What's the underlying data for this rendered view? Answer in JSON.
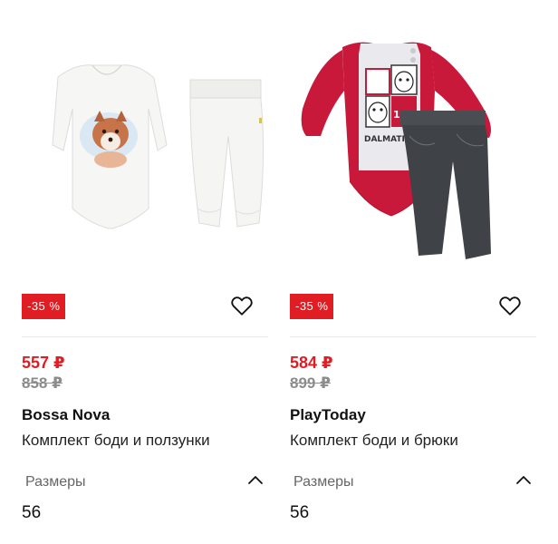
{
  "products": [
    {
      "discount": "-35 %",
      "price_new": "557 ₽",
      "price_old": "858 ₽",
      "brand": "Bossa Nova",
      "title": "Комплект боди и ползунки",
      "sizes_label": "Размеры",
      "size": "56"
    },
    {
      "discount": "-35 %",
      "price_new": "584 ₽",
      "price_old": "899 ₽",
      "brand": "PlayToday",
      "title": "Комплект боди и брюки",
      "sizes_label": "Размеры",
      "size": "56"
    }
  ],
  "icons": {
    "favorite": "heart-outline-icon",
    "toggle": "chevron-up-icon"
  },
  "colors": {
    "accent": "#e11d24",
    "old_price": "#8c8c8c"
  }
}
